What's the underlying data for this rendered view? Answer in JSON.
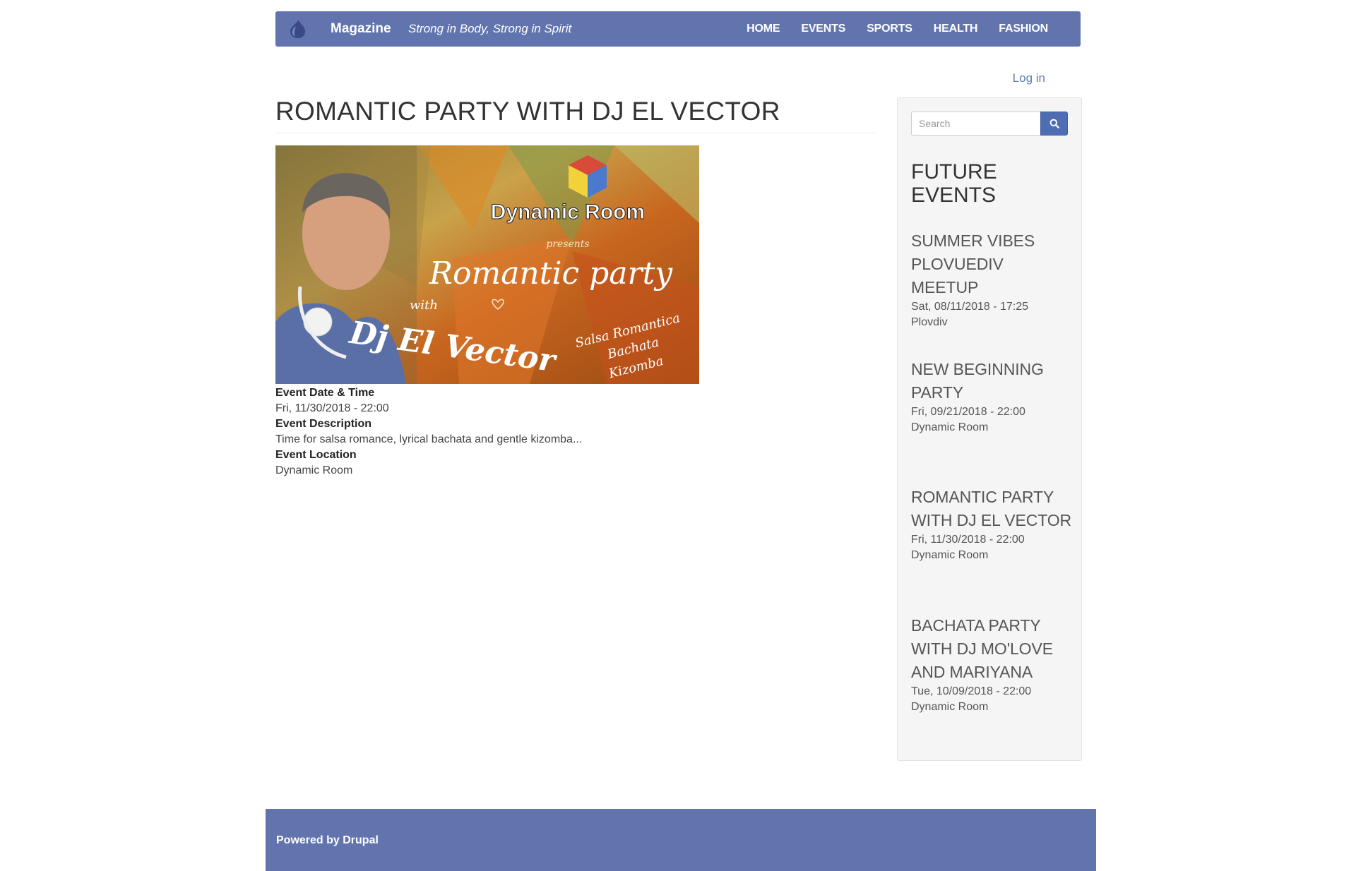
{
  "header": {
    "site_name": "Magazine",
    "slogan": "Strong in Body, Strong in Spirit",
    "nav": [
      "HOME",
      "EVENTS",
      "SPORTS",
      "HEALTH",
      "FASHION"
    ],
    "logo_icon": "drupal-drop-icon"
  },
  "user": {
    "login_label": "Log in"
  },
  "main": {
    "title": "ROMANTIC PARTY WITH DJ EL VECTOR",
    "image": {
      "brand": "Dynamic Room",
      "presents": "presents",
      "headline": "Romantic party",
      "with": "with",
      "dj": "Dj El Vector",
      "styles": [
        "Salsa Romantica",
        "Bachata",
        "Kizomba"
      ]
    },
    "fields": {
      "date_label": "Event Date & Time",
      "date_value": "Fri, 11/30/2018 - 22:00",
      "desc_label": "Event Description",
      "desc_value": "Time for salsa romance, lyrical bachata and gentle kizomba...",
      "loc_label": "Event Location",
      "loc_value": "Dynamic Room"
    }
  },
  "sidebar": {
    "search_placeholder": "Search",
    "title": "FUTURE EVENTS",
    "events": [
      {
        "title": "SUMMER VIBES PLOVUEDIV MEETUP",
        "date": "Sat, 08/11/2018 - 17:25",
        "location": "Plovdiv"
      },
      {
        "title": "NEW BEGINNING PARTY",
        "date": "Fri, 09/21/2018 - 22:00",
        "location": "Dynamic Room"
      },
      {
        "title": "ROMANTIC PARTY WITH DJ EL VECTOR",
        "date": "Fri, 11/30/2018 - 22:00",
        "location": "Dynamic Room"
      },
      {
        "title": "BACHATA PARTY WITH DJ MO'LOVE AND MARIYANA",
        "date": "Tue, 10/09/2018 - 22:00",
        "location": "Dynamic Room"
      }
    ]
  },
  "footer": {
    "text": "Powered by Drupal"
  },
  "colors": {
    "brand": "#6174ad",
    "link": "#5e7bb1",
    "button": "#4e6db3"
  }
}
